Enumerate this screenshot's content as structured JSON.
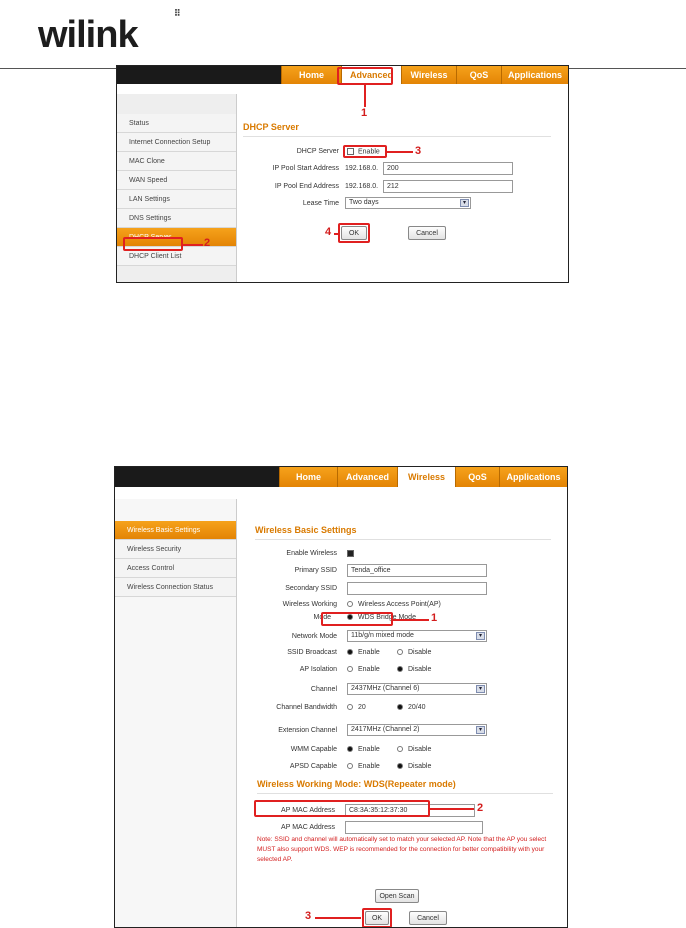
{
  "brand": {
    "logo_text": "wilink"
  },
  "top": {
    "tabs": [
      "Home",
      "Advanced",
      "Wireless",
      "QoS",
      "Applications"
    ],
    "sidebar": [
      "Status",
      "Internet Connection Setup",
      "MAC Clone",
      "WAN Speed",
      "LAN Settings",
      "DNS Settings",
      "DHCP Server",
      "DHCP Client List"
    ],
    "title": "DHCP Server",
    "fields": {
      "dhcp_label": "DHCP Server",
      "dhcp_enable": "Enable",
      "start_label": "IP Pool Start Address",
      "start_prefix": "192.168.0.",
      "start_value": "200",
      "end_label": "IP Pool End Address",
      "end_prefix": "192.168.0.",
      "end_value": "212",
      "lease_label": "Lease Time",
      "lease_value": "Two days"
    },
    "ok": "OK",
    "cancel": "Cancel",
    "markers": [
      "1",
      "2",
      "3",
      "4"
    ]
  },
  "bottom": {
    "tabs": [
      "Home",
      "Advanced",
      "Wireless",
      "QoS",
      "Applications"
    ],
    "sidebar": [
      "Wireless Basic Settings",
      "Wireless Security",
      "Access Control",
      "Wireless Connection Status"
    ],
    "title": "Wireless Basic Settings",
    "fields": {
      "enable_label": "Enable Wireless",
      "pssid_label": "Primary SSID",
      "pssid_value": "Tenda_office",
      "sssid_label": "Secondary SSID",
      "mode_label_1": "Wireless Working",
      "mode_label_2": "Mode",
      "mode_opt1": "Wireless Access Point(AP)",
      "mode_opt2": "WDS Bridge Mode",
      "netmode_label": "Network Mode",
      "netmode_value": "11b/g/n mixed mode",
      "ssidb_label": "SSID Broadcast",
      "apiso_label": "AP Isolation",
      "channel_label": "Channel",
      "channel_value": "2437MHz (Channel 6)",
      "bw_label": "Channel Bandwidth",
      "bw_opt1": "20",
      "bw_opt2": "20/40",
      "ext_label": "Extension Channel",
      "ext_value": "2417MHz (Channel 2)",
      "wmm_label": "WMM Capable",
      "apsd_label": "APSD Capable",
      "enable": "Enable",
      "disable": "Disable"
    },
    "wds_title": "Wireless Working Mode: WDS(Repeater mode)",
    "ap_mac_label": "AP MAC Address",
    "ap_mac_value": "C8:3A:35:12:37:30",
    "ap_mac_label2": "AP MAC Address",
    "note": "Note: SSID and channel will automatically set to match your selected AP. Note that the AP you select MUST also support WDS. WEP is recommended for the connection for better compatibility with your selected AP.",
    "open_scan": "Open Scan",
    "ok": "OK",
    "cancel": "Cancel",
    "markers": [
      "1",
      "2",
      "3"
    ]
  },
  "colors": {
    "accent": "#e38405",
    "marker": "#e02020"
  }
}
